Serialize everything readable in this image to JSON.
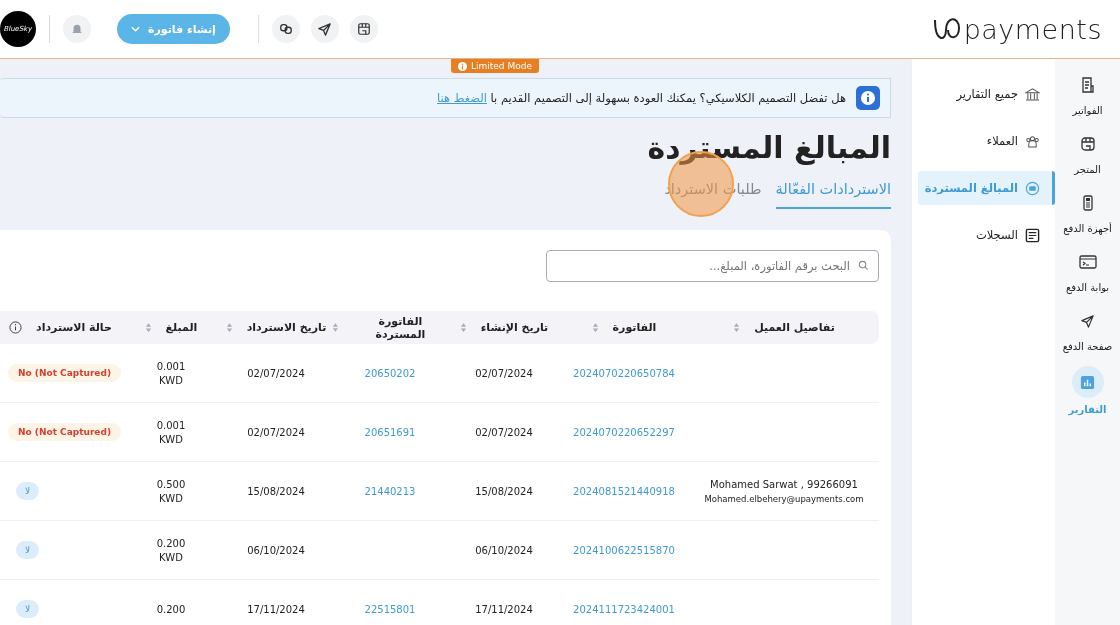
{
  "header": {
    "logo_text": "payments",
    "create_button": "إنشاء فاتورة",
    "avatar_text": "BlueSky"
  },
  "limited_badge": "Limited Mode",
  "rail": [
    {
      "label": "الفواتير",
      "selected": false
    },
    {
      "label": "المتجر",
      "selected": false
    },
    {
      "label": "أجهزة الدفع",
      "selected": false
    },
    {
      "label": "بوابة الدفع",
      "selected": false
    },
    {
      "label": "صفحة الدفع",
      "selected": false
    },
    {
      "label": "التقارير",
      "selected": true
    }
  ],
  "submenu": [
    {
      "label": "جميع التقارير",
      "selected": false
    },
    {
      "label": "العملاء",
      "selected": false
    },
    {
      "label": "المبالغ المستردة",
      "selected": true
    },
    {
      "label": "السجلات",
      "selected": false
    }
  ],
  "banner": {
    "text": "هل تفضل التصميم الكلاسيكي؟ يمكنك العودة بسهولة إلى التصميم القديم با",
    "link": "الضغط هنا"
  },
  "title": "المبالغ المستردة",
  "tabs": [
    {
      "label": "الاستردادات الفعّالة",
      "selected": true
    },
    {
      "label": "طلبات الاسترداد",
      "selected": false
    }
  ],
  "search": {
    "placeholder": "البحث برقم الفاتورة، المبلغ..."
  },
  "table": {
    "columns": [
      "تفاصيل العميل",
      "الفاتورة",
      "تاريخ الإنشاء",
      "الفاتورة المستردة",
      "تاريخ الاسترداد",
      "المبلغ",
      "حالة الاسترداد"
    ],
    "rows": [
      {
        "invoice": "2024070220650784",
        "created": "02/07/2024",
        "refund_invoice": "20650202",
        "refund_date": "02/07/2024",
        "amount": "0.001",
        "currency": "KWD",
        "status": {
          "kind": "not_captured",
          "label": "No (Not Captured)"
        }
      },
      {
        "invoice": "2024070220652297",
        "created": "02/07/2024",
        "refund_invoice": "20651691",
        "refund_date": "02/07/2024",
        "amount": "0.001",
        "currency": "KWD",
        "status": {
          "kind": "not_captured",
          "label": "No (Not Captured)"
        }
      },
      {
        "customer": "Mohamed Sarwat , 99266091",
        "customer_email": "Mohamed.elbehery@upayments.com",
        "invoice": "2024081521440918",
        "created": "15/08/2024",
        "refund_invoice": "21440213",
        "refund_date": "15/08/2024",
        "amount": "0.500",
        "currency": "KWD",
        "status": {
          "kind": "no",
          "label": "لا"
        }
      },
      {
        "invoice": "2024100622515870",
        "created": "06/10/2024",
        "refund_date": "06/10/2024",
        "amount": "0.200",
        "currency": "KWD",
        "status": {
          "kind": "no",
          "label": "لا"
        }
      },
      {
        "invoice": "2024111723424001",
        "created": "17/11/2024",
        "refund_invoice": "22515801",
        "refund_date": "17/11/2024",
        "amount": "0.200",
        "status": {
          "kind": "no",
          "label": "لا"
        }
      }
    ]
  }
}
